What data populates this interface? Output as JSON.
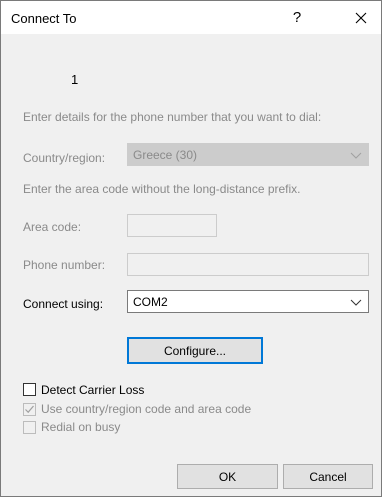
{
  "window": {
    "title": "Connect To",
    "help_label": "?"
  },
  "connection": {
    "name": "1"
  },
  "form": {
    "instruction": "Enter details for the phone number that you want to dial:",
    "country_label": "Country/region:",
    "country_value": "Greece (30)",
    "area_instruction": "Enter the area code without the long-distance prefix.",
    "area_label": "Area code:",
    "area_value": "",
    "phone_label": "Phone number:",
    "phone_value": "",
    "connect_using_label": "Connect using:",
    "connect_using_value": "COM2",
    "configure_label": "Configure..."
  },
  "options": {
    "detect_carrier_loss": {
      "label": "Detect Carrier Loss",
      "checked": false,
      "enabled": true
    },
    "use_country_code": {
      "label": "Use country/region code and area code",
      "checked": true,
      "enabled": false
    },
    "redial_on_busy": {
      "label": "Redial on busy",
      "checked": false,
      "enabled": false
    }
  },
  "buttons": {
    "ok": "OK",
    "cancel": "Cancel"
  },
  "colors": {
    "focus_border": "#0078d7",
    "disabled_text": "#8a8a8a"
  },
  "icons": {
    "close": "close-icon",
    "dropdown": "chevron-down-icon",
    "check": "checkmark-icon"
  }
}
